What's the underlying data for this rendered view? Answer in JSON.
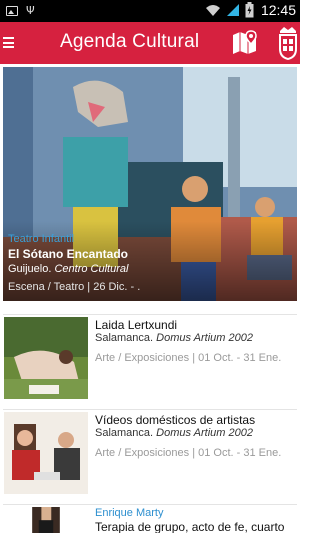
{
  "status_bar": {
    "time": "12:45",
    "icons": [
      "image-notification-icon",
      "usb-icon",
      "wifi-icon",
      "signal-icon",
      "battery-icon"
    ]
  },
  "app_bar": {
    "title": "Agenda Cultural",
    "menu_icon": "hamburger-menu-icon",
    "map_icon": "map-pin-icon",
    "logo": "crest-logo",
    "color": "#d6213f"
  },
  "featured": {
    "category": "Teatro Infantil",
    "title": "El Sótano Encantado",
    "city": "Guijuelo.",
    "venue": "Centro Cultural",
    "meta": "Escena / Teatro | 26 Dic. - ."
  },
  "events": [
    {
      "category": "",
      "title": "Laida Lertxundi",
      "city": "Salamanca.",
      "venue": "Domus Artium 2002",
      "meta": "Arte / Exposiciones | 01 Oct. - 31 Ene."
    },
    {
      "category": "",
      "title": "Vídeos domésticos de artistas",
      "city": "Salamanca.",
      "venue": "Domus Artium 2002",
      "meta": "Arte / Exposiciones | 01 Oct. - 31 Ene."
    },
    {
      "category": "Enrique Marty",
      "title": "Terapia de grupo, acto de fe, cuarto",
      "city": "",
      "venue": "",
      "meta": ""
    }
  ],
  "colors": {
    "accent": "#d6213f",
    "category_blue": "#2d8fcf"
  }
}
